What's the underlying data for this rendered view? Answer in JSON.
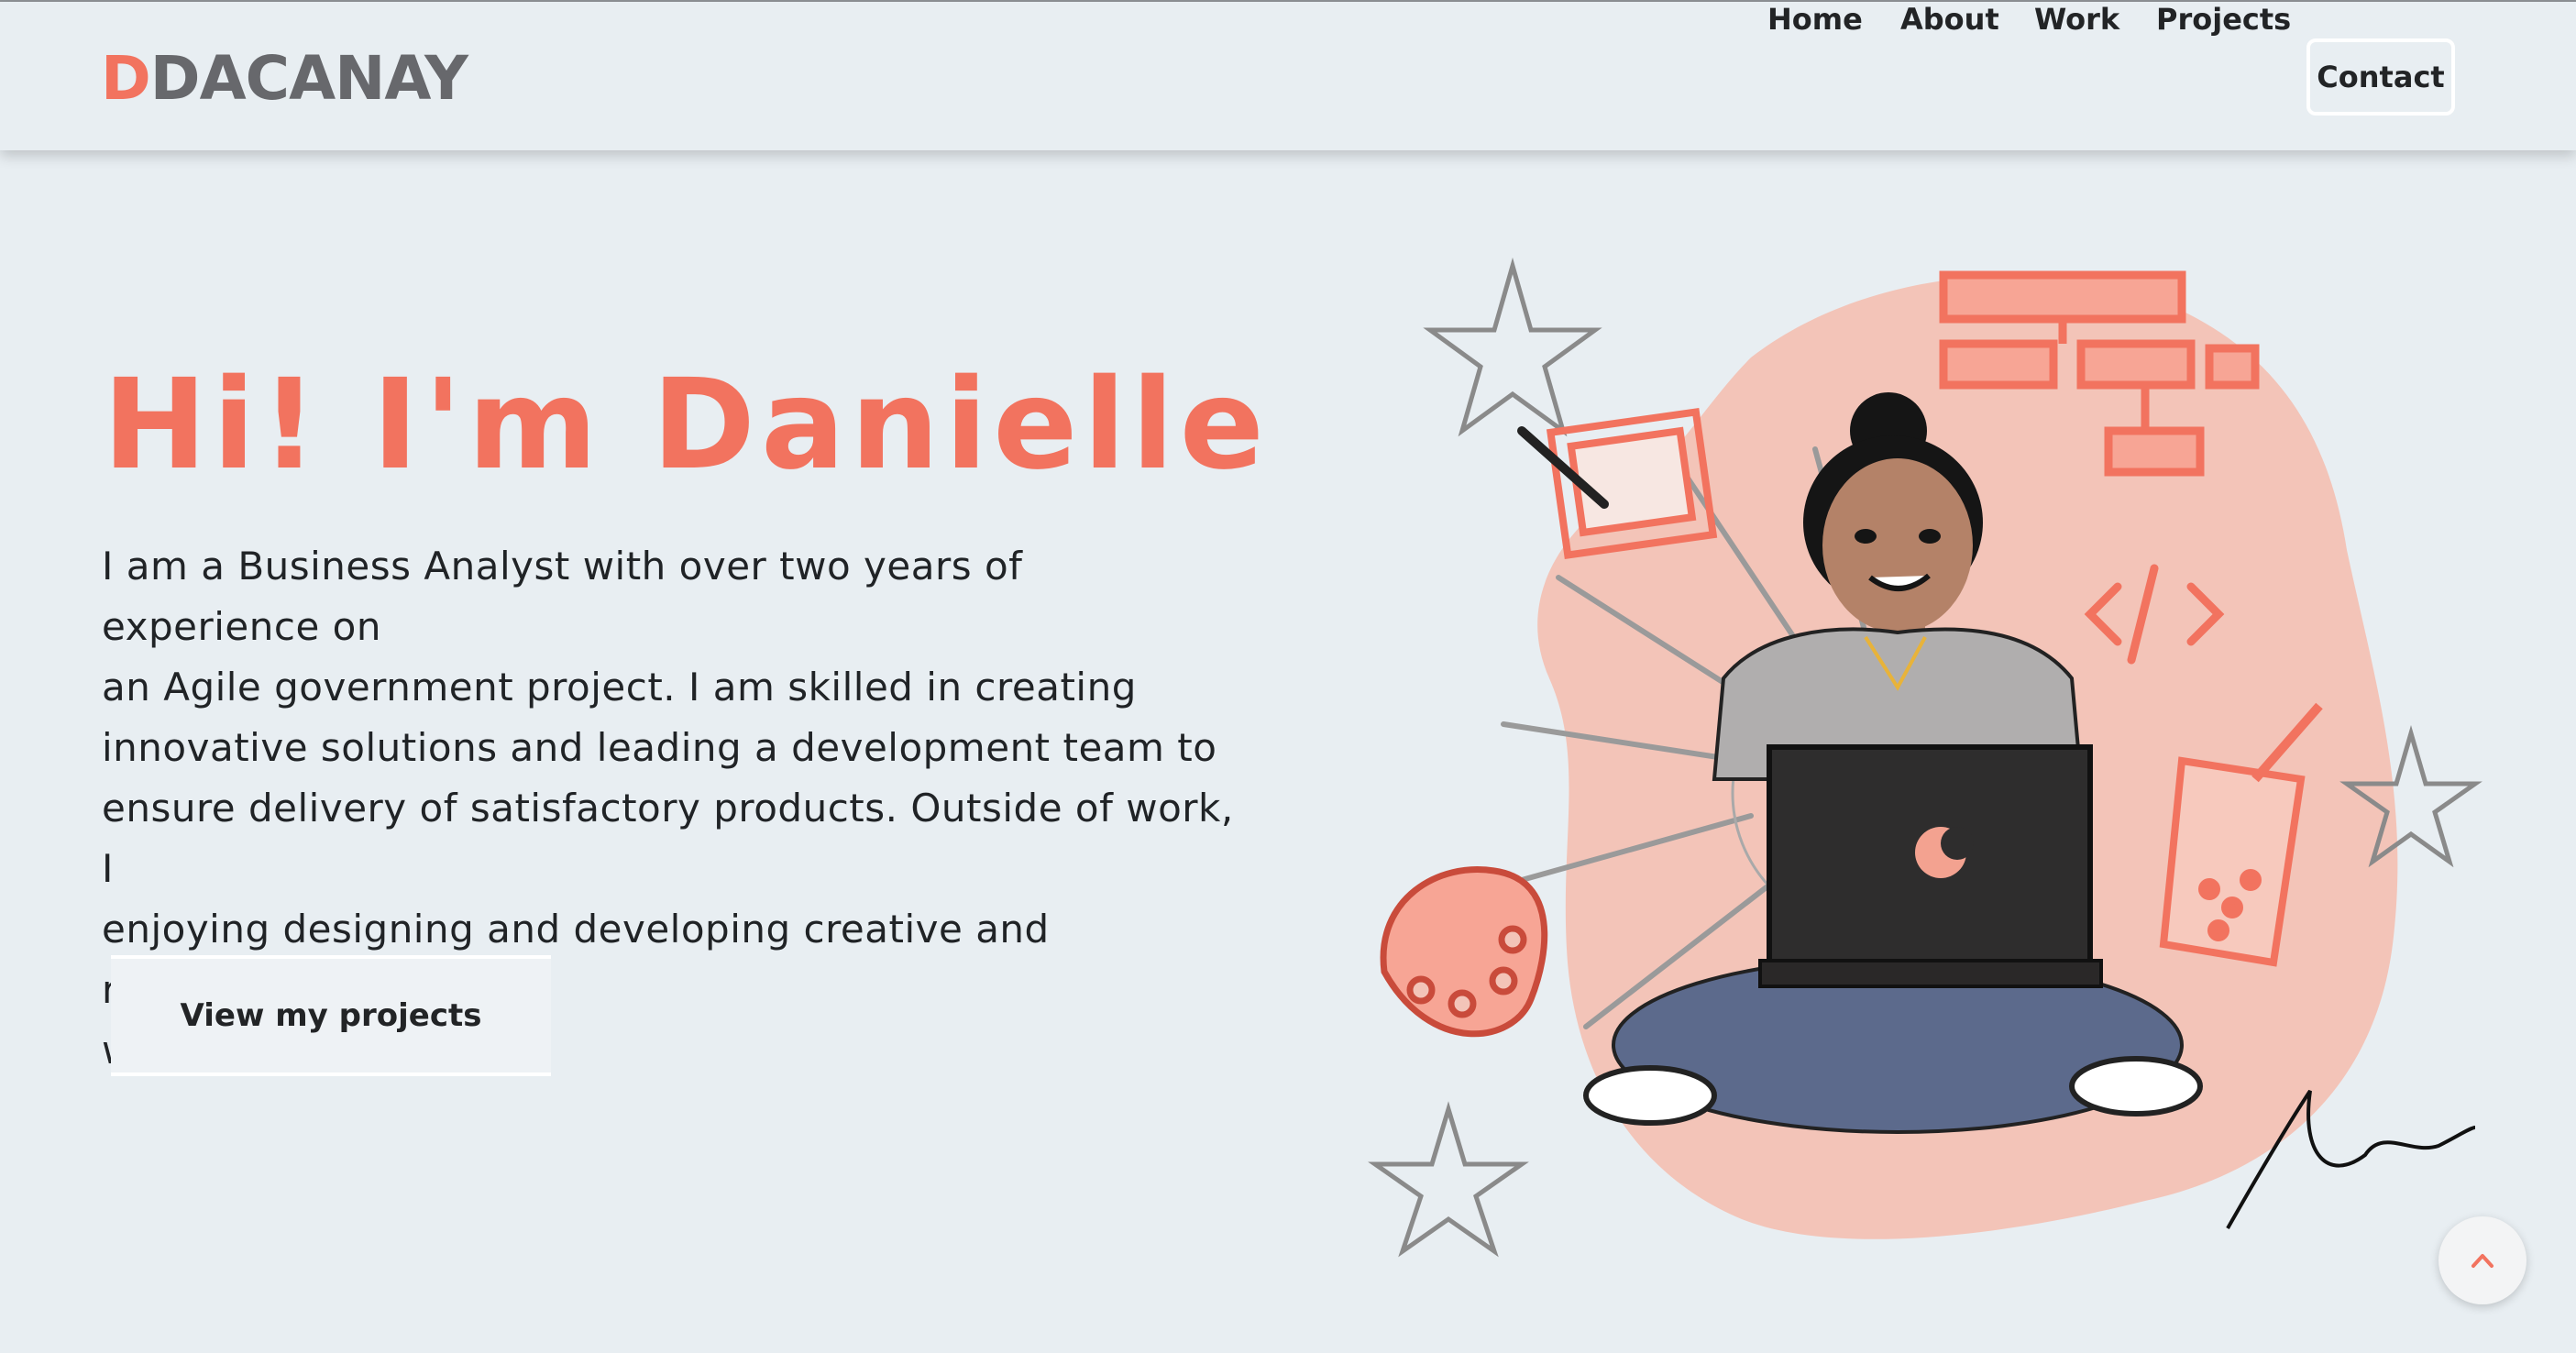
{
  "logo": {
    "accent": "D",
    "text": "DACANAY"
  },
  "nav": {
    "items": [
      "Home",
      "About",
      "Work",
      "Projects"
    ],
    "contact": "Contact"
  },
  "hero": {
    "title": "Hi! I'm Danielle",
    "lines": [
      "I am a Business Analyst with over two years of experience on",
      "an Agile government project. I am skilled in creating",
      "innovative solutions and leading a development team to",
      "ensure delivery of satisfactory products. Outside of work, I",
      "enjoying designing and developing creative and responsive",
      "web applications."
    ],
    "cta": "View my projects"
  },
  "colors": {
    "accent": "#f2735f",
    "background": "#e8eef2",
    "text": "#202326"
  },
  "icons": {
    "scroll_top": "chevron-up-icon"
  }
}
